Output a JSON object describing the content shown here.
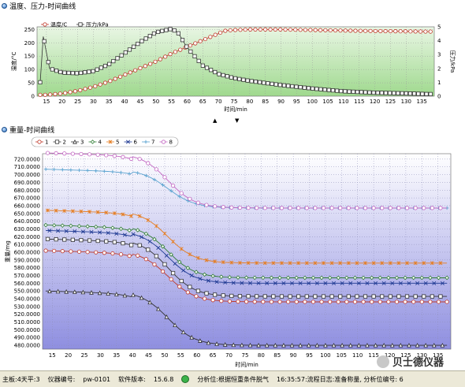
{
  "panel1": {
    "title": "温度、压力-时间曲线"
  },
  "panel2": {
    "title": "重量-时间曲线"
  },
  "colors": {
    "temperature": "#c0392b",
    "pressure": "#333333",
    "plot_bg_top": "#e9f6e4",
    "plot_bg_bottom": "#9fd98e",
    "weight_bg_top": "#ffffff",
    "weight_bg_bottom": "#8e8ee0"
  },
  "status": {
    "board": "主板:4天平:3",
    "instrument": "仪器编号:",
    "instrument_value": "pw-0101",
    "software": "软件版本:",
    "software_value": "15.6.8",
    "analysis": "分析位:根据恒重条件脱气",
    "log": "16:35:57:流程日志:准备称量, 分析位编号: 6"
  },
  "watermark": {
    "text": "贝士德仪器"
  },
  "chart_data": [
    {
      "type": "line",
      "title": "温度、压力-时间曲线",
      "xlabel": "时间/min",
      "ylabel": "温度/°C",
      "y2label": "压力/kPa",
      "xlim": [
        12,
        139
      ],
      "ylim": [
        0,
        260
      ],
      "y2lim": [
        0,
        5
      ],
      "x_ticks": [
        15,
        20,
        25,
        30,
        35,
        40,
        45,
        50,
        55,
        60,
        65,
        70,
        75,
        80,
        85,
        90,
        95,
        100,
        105,
        110,
        115,
        120,
        125,
        130,
        135
      ],
      "y_ticks": [
        0,
        50,
        100,
        150,
        200,
        250
      ],
      "y2_ticks": [
        0,
        1,
        2,
        3,
        4,
        5
      ],
      "grid": true,
      "legend": "top-left",
      "series": [
        {
          "name": "温度/C",
          "axis": "left",
          "x": [
            13,
            15,
            20,
            25,
            30,
            35,
            40,
            45,
            50,
            55,
            60,
            65,
            70,
            72,
            75,
            80,
            90,
            100,
            110,
            120,
            130,
            137
          ],
          "y": [
            5,
            5,
            10,
            20,
            35,
            55,
            80,
            105,
            130,
            160,
            185,
            210,
            235,
            245,
            248,
            250,
            250,
            248,
            246,
            244,
            243,
            242
          ]
        },
        {
          "name": "压力/kPa",
          "axis": "right",
          "x": [
            13,
            14,
            16,
            20,
            25,
            30,
            35,
            40,
            45,
            50,
            55,
            57,
            60,
            65,
            70,
            75,
            80,
            90,
            100,
            110,
            120,
            130,
            137
          ],
          "y": [
            1.0,
            4.3,
            2.0,
            1.7,
            1.65,
            1.8,
            2.3,
            3.1,
            3.9,
            4.6,
            4.85,
            4.6,
            3.5,
            2.2,
            1.6,
            1.3,
            1.1,
            0.8,
            0.55,
            0.35,
            0.25,
            0.2,
            0.15
          ]
        }
      ]
    },
    {
      "type": "line",
      "title": "重量-时间曲线",
      "xlabel": "时间/min",
      "ylabel": "重量/mg",
      "xlim": [
        12,
        139
      ],
      "ylim": [
        475,
        727
      ],
      "x_ticks": [
        15,
        20,
        25,
        30,
        35,
        40,
        45,
        50,
        55,
        60,
        65,
        70,
        75,
        80,
        85,
        90,
        95,
        100,
        105,
        110,
        115,
        120,
        125,
        130,
        135
      ],
      "y_ticks": [
        480,
        490,
        500,
        510,
        520,
        530,
        540,
        550,
        560,
        570,
        580,
        590,
        600,
        610,
        620,
        630,
        640,
        650,
        660,
        670,
        680,
        690,
        700,
        710,
        720
      ],
      "y_tick_labels": [
        "480.0000",
        "490.0000",
        "500.0000",
        "510.0000",
        "520.0000",
        "530.0000",
        "540.0000",
        "550.0000",
        "560.0000",
        "570.0000",
        "580.0000",
        "590.0000",
        "600.0000",
        "610.0000",
        "620.0000",
        "630.0000",
        "640.0000",
        "650.0000",
        "660.0000",
        "670.0000",
        "680.0000",
        "690.0000",
        "700.0000",
        "710.0000",
        "720.0000"
      ],
      "grid": true,
      "legend": "top-left",
      "series": [
        {
          "name": "1",
          "start": 602,
          "end": 536,
          "color": "#c0392b",
          "marker": "circle"
        },
        {
          "name": "2",
          "start": 617,
          "end": 543,
          "color": "#333333",
          "marker": "square"
        },
        {
          "name": "3",
          "start": 550,
          "end": 480,
          "color": "#333333",
          "marker": "triangle"
        },
        {
          "name": "4",
          "start": 635,
          "end": 567,
          "color": "#2e7d32",
          "marker": "diamond"
        },
        {
          "name": "5",
          "start": 654,
          "end": 586,
          "color": "#e67e22",
          "marker": "star"
        },
        {
          "name": "6",
          "start": 628,
          "end": 560,
          "color": "#1f3a93",
          "marker": "cross"
        },
        {
          "name": "7",
          "start": 707,
          "end": 657,
          "color": "#5ba3d0",
          "marker": "plus"
        },
        {
          "name": "8",
          "start": 728,
          "end": 657,
          "color": "#c266c2",
          "marker": "circle"
        }
      ]
    }
  ]
}
